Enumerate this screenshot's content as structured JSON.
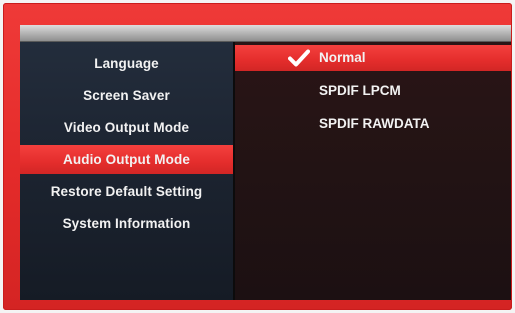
{
  "menu": {
    "items": [
      {
        "label": "Language",
        "selected": false
      },
      {
        "label": "Screen Saver",
        "selected": false
      },
      {
        "label": "Video Output Mode",
        "selected": false
      },
      {
        "label": "Audio Output Mode",
        "selected": true
      },
      {
        "label": "Restore Default Setting",
        "selected": false
      },
      {
        "label": "System Information",
        "selected": false
      }
    ]
  },
  "options": {
    "items": [
      {
        "label": "Normal",
        "selected": true,
        "icon": "check-icon"
      },
      {
        "label": "SPDIF LPCM",
        "selected": false
      },
      {
        "label": "SPDIF RAWDATA",
        "selected": false
      }
    ]
  },
  "colors": {
    "frame": "#e42b2a",
    "highlight": "#e42d2c",
    "sidebar": "#1d2532",
    "content": "#221314",
    "text": "#f2f2f2"
  }
}
